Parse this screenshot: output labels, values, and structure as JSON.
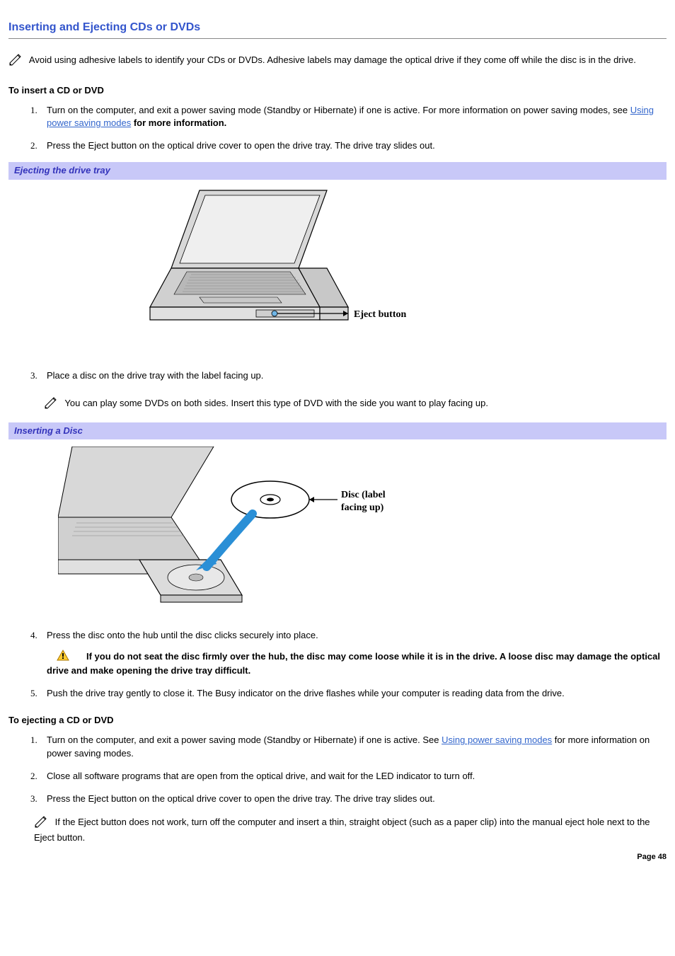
{
  "title": "Inserting and Ejecting CDs or DVDs",
  "intro_note": "Avoid using adhesive labels to identify your CDs or DVDs. Adhesive labels may damage the optical drive if they come off while the disc is in the drive.",
  "insert": {
    "heading": "To insert a CD or DVD",
    "step1_pre": "Turn on the computer, and exit a power saving mode (Standby or Hibernate) if one is active. For more information on power saving modes, see ",
    "step1_link": "Using power saving modes",
    "step1_post": " for more information.",
    "step2": "Press the Eject button on the optical drive cover to open the drive tray. The drive tray slides out.",
    "fig1_caption": "Ejecting the drive tray",
    "fig1_label": "Eject button",
    "step3": "Place a disc on the drive tray with the label facing up.",
    "step3_note": "You can play some DVDs on both sides. Insert this type of DVD with the side you want to play facing up.",
    "fig2_caption": "Inserting a Disc",
    "fig2_label1": "Disc (label",
    "fig2_label2": "facing up)",
    "step4": "Press the disc onto the hub until the disc clicks securely into place.",
    "warning": "If you do not seat the disc firmly over the hub, the disc may come loose while it is in the drive. A loose disc may damage the optical drive and make opening the drive tray difficult.",
    "step5": "Push the drive tray gently to close it. The Busy indicator on the drive flashes while your computer is reading data from the drive."
  },
  "eject": {
    "heading": "To ejecting a CD or DVD",
    "step1_pre": "Turn on the computer, and exit a power saving mode (Standby or Hibernate) if one is active. See ",
    "step1_link": "Using power saving modes",
    "step1_post": " for more information on power saving modes.",
    "step2": "Close all software programs that are open from the optical drive, and wait for the LED indicator to turn off.",
    "step3": "Press the Eject button on the optical drive cover to open the drive tray. The drive tray slides out.",
    "note": "If the Eject button does not work, turn off the computer and insert a thin, straight object (such as a paper clip) into the manual eject hole next to the Eject button."
  },
  "page_number": "Page 48"
}
